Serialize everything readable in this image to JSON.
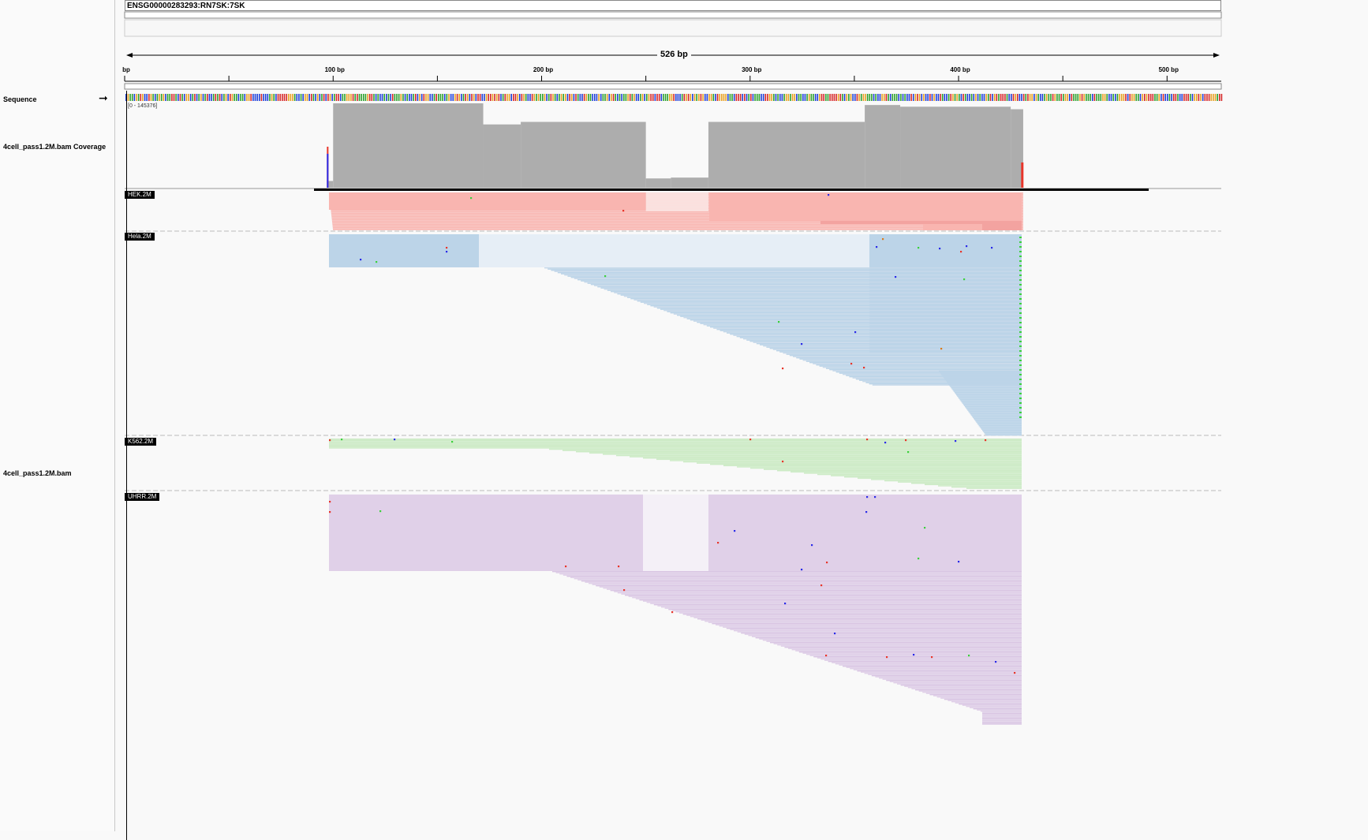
{
  "locus": {
    "name": "ENSG00000283293:RN7SK:7SK"
  },
  "ruler": {
    "span_label": "526 bp",
    "ticks": [
      {
        "label": "bp",
        "bp": 0
      },
      {
        "label": "100 bp",
        "bp": 100
      },
      {
        "label": "200 bp",
        "bp": 200
      },
      {
        "label": "300 bp",
        "bp": 300
      },
      {
        "label": "400 bp",
        "bp": 400
      },
      {
        "label": "500 bp",
        "bp": 500
      }
    ],
    "total_bp": 526
  },
  "tracks": {
    "sequence_label": "Sequence",
    "coverage_label": "4cell_pass1.2M.bam Coverage",
    "coverage_range": "[0 - 145376]",
    "alignment_label": "4cell_pass1.2M.bam"
  },
  "samples": [
    {
      "name": "HEK.2M",
      "color": "#f9b5b0"
    },
    {
      "name": "Hela.2M",
      "color": "#bcd4e8"
    },
    {
      "name": "K562.2M",
      "color": "#cdebc6"
    },
    {
      "name": "UHRR.2M",
      "color": "#e0d0e8"
    }
  ],
  "colors": {
    "coverage": "#adadad",
    "mismatch_red": "#e8352a",
    "mismatch_blue": "#2a2ae8",
    "mismatch_green": "#3bd13b",
    "mismatch_orange": "#d97a1a"
  }
}
